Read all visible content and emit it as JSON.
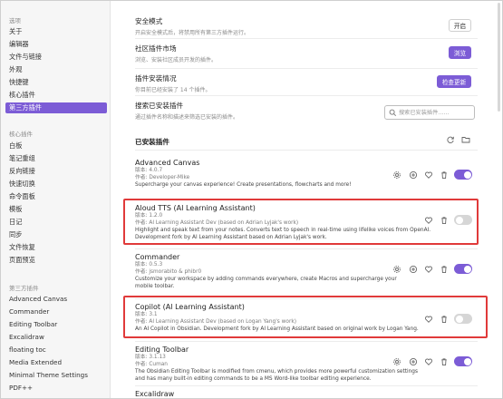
{
  "sidebar": {
    "section_options": "选项",
    "options_items": [
      "关于",
      "编辑器",
      "文件与链接",
      "外观",
      "快捷键",
      "核心插件",
      "第三方插件"
    ],
    "active_index": 6,
    "section_core": "核心插件",
    "core_items": [
      "白板",
      "笔记重组",
      "反向链接",
      "快速切换",
      "命令面板",
      "模板",
      "日记",
      "同步",
      "文件恢复",
      "页面预览"
    ],
    "section_third": "第三方插件",
    "third_items": [
      "Advanced Canvas",
      "Commander",
      "Editing Toolbar",
      "Excalidraw",
      "floating toc",
      "Media Extended",
      "Minimal Theme Settings",
      "PDF++"
    ]
  },
  "settings": {
    "safe_mode": {
      "title": "安全模式",
      "desc": "开启安全模式后，将禁用所有第三方插件运行。",
      "button": "开启"
    },
    "community": {
      "title": "社区插件市场",
      "desc": "浏览、安装社区成员开发的插件。",
      "button": "浏览"
    },
    "updates": {
      "title": "插件安装情况",
      "desc": "你目前已经安装了 14 个插件。",
      "button": "检查更新"
    },
    "search": {
      "title": "搜索已安装插件",
      "desc": "通过插件名称和描述来筛选已安装的插件。",
      "placeholder": "搜索已安装插件……"
    }
  },
  "installed_header": "已安装插件",
  "plugins": [
    {
      "name": "Advanced Canvas",
      "version": "版本: 4.0.7",
      "author": "作者: Developer-Mike",
      "desc1": "Supercharge your canvas experience! Create presentations, flowcharts and more!",
      "desc2": "",
      "enabled": true
    },
    {
      "name": "Aloud TTS (AI Learning Assistant)",
      "version": "版本: 1.2.0",
      "author": "作者: AI Learning Assistant Dev (based on Adrian Lyjak's work)",
      "desc1": "Highlight and speak text from your notes. Converts text to speech in real-time using lifelike voices from OpenAI.",
      "desc2": "Development fork by AI Learning Assistant based on Adrian Lyjak's work.",
      "enabled": false
    },
    {
      "name": "Commander",
      "version": "版本: 0.5.3",
      "author": "作者: jsmorabito & phibr0",
      "desc1": "Customize your workspace by adding commands everywhere, create Macros and supercharge your",
      "desc2": "mobile toolbar.",
      "enabled": true
    },
    {
      "name": "Copilot (AI Learning Assistant)",
      "version": "版本: 3.1",
      "author": "作者: AI Learning Assistant Dev (based on Logan Yang's work)",
      "desc1": "An AI Copilot in Obsidian. Development fork by AI Learning Assistant based on original work by Logan Yang.",
      "desc2": "",
      "enabled": false
    },
    {
      "name": "Editing Toolbar",
      "version": "版本: 3.1.13",
      "author": "作者: Cuman",
      "desc1": "The Obsidian Editing Toolbar is modified from cmenu, which provides more powerful customization settings",
      "desc2": "and has many built-in editing commands to be a MS Word-like toolbar editing experience.",
      "enabled": true
    },
    {
      "name": "Excalidraw",
      "version": "",
      "author": "",
      "desc1": "",
      "desc2": "",
      "enabled": true
    }
  ],
  "icons": {
    "settings": "gear-icon",
    "hotkeys": "circle-plus-icon",
    "favorite": "heart-icon",
    "uninstall": "trash-icon",
    "refresh": "refresh-icon",
    "folder": "folder-icon",
    "search": "search-icon"
  },
  "colors": {
    "accent": "#7c5cd6",
    "highlight": "#e03a3a"
  }
}
